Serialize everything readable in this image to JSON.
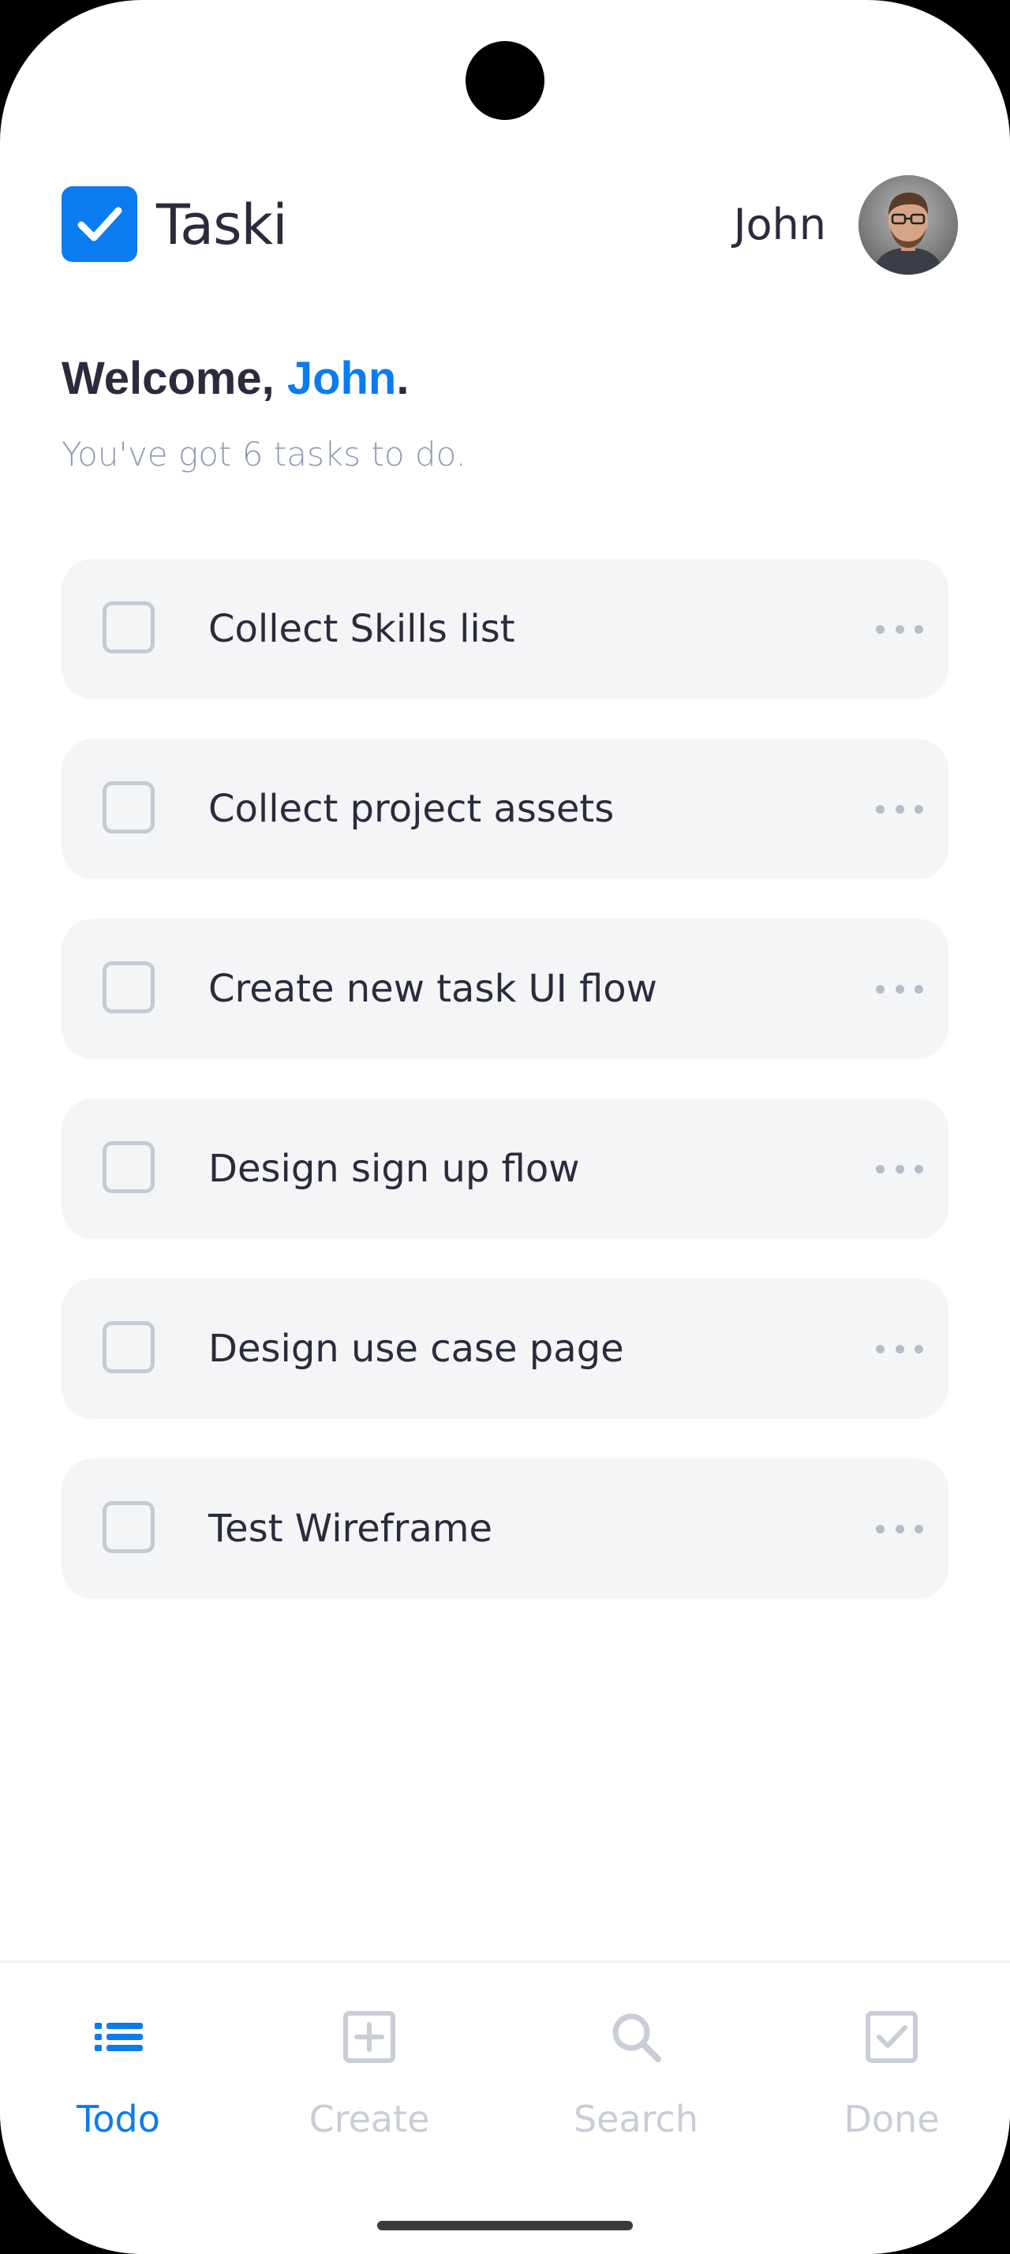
{
  "app": {
    "name": "Taski",
    "logo_icon": "check-square-icon",
    "brand_color": "#0b7bf0"
  },
  "user": {
    "name": "John",
    "avatar_icon": "avatar-icon"
  },
  "welcome": {
    "prefix": "Welcome, ",
    "name": "John",
    "suffix": ".",
    "subtitle": "You've got 6 tasks to do."
  },
  "tasks": [
    {
      "label": "Collect Skills list",
      "checked": false
    },
    {
      "label": "Collect project assets",
      "checked": false
    },
    {
      "label": "Create new task UI flow",
      "checked": false
    },
    {
      "label": "Design sign up flow",
      "checked": false
    },
    {
      "label": "Design use case page",
      "checked": false
    },
    {
      "label": "Test Wireframe",
      "checked": false
    }
  ],
  "nav": {
    "items": [
      {
        "label": "Todo",
        "icon": "list-icon",
        "active": true
      },
      {
        "label": "Create",
        "icon": "plus-square-icon",
        "active": false
      },
      {
        "label": "Search",
        "icon": "search-icon",
        "active": false
      },
      {
        "label": "Done",
        "icon": "check-square-icon",
        "active": false
      }
    ]
  }
}
